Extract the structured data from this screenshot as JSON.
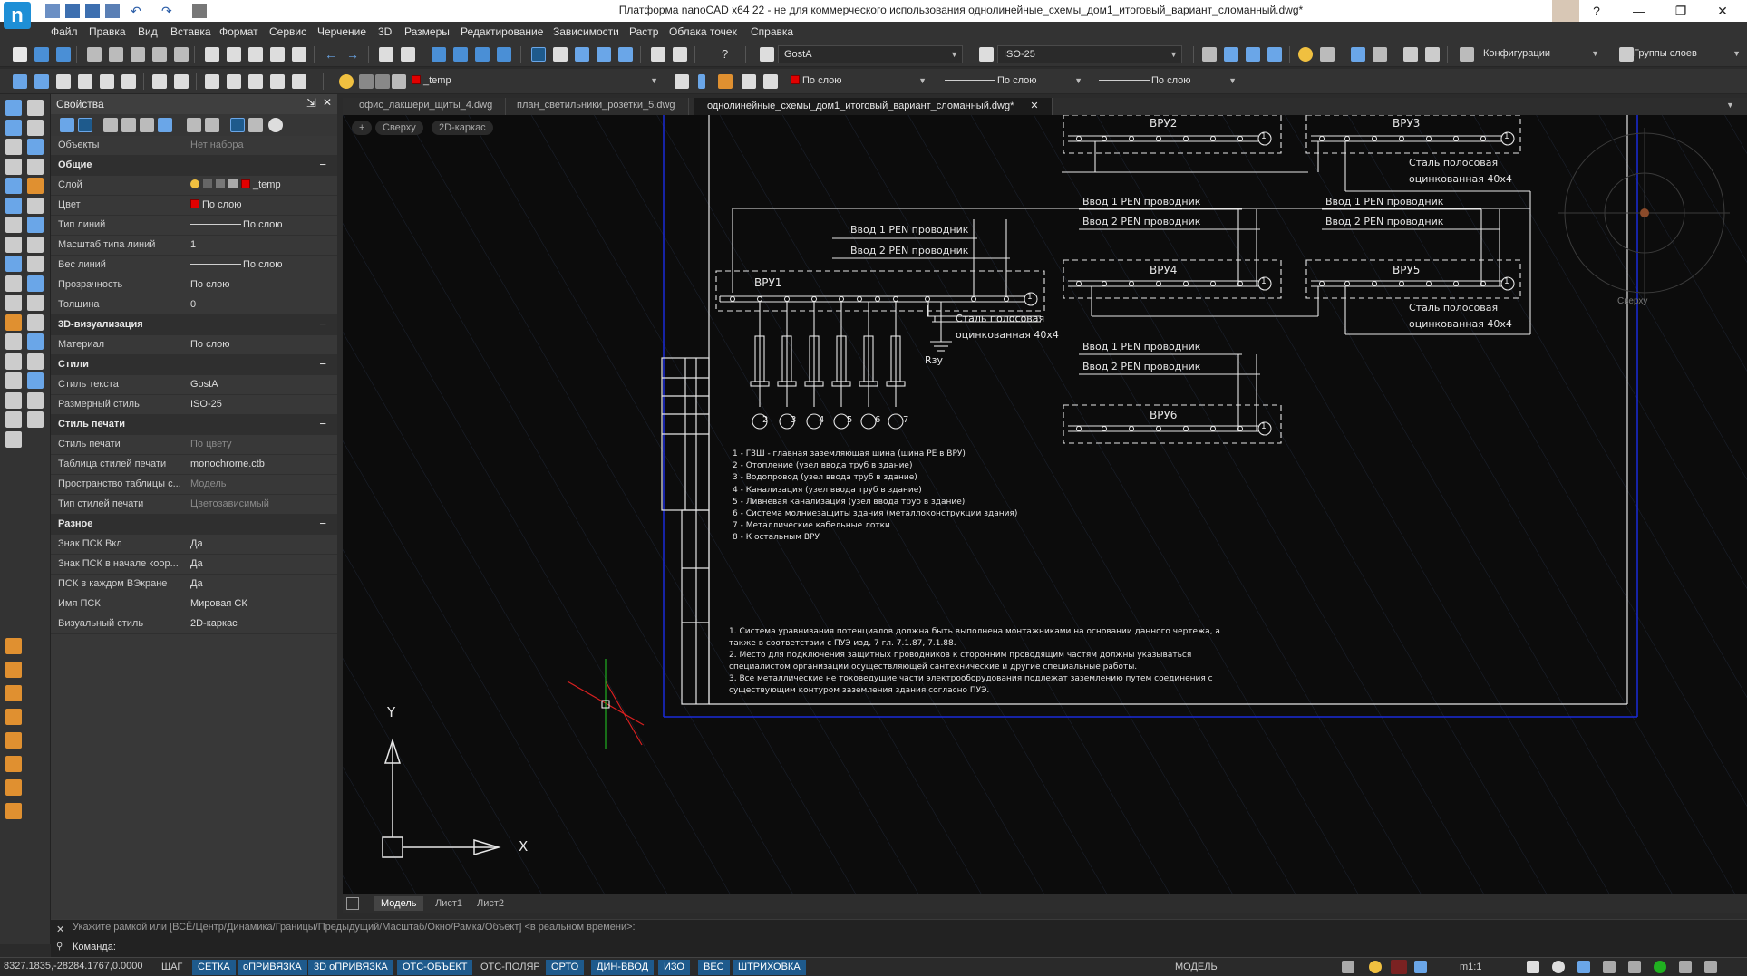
{
  "window": {
    "title": "Платформа nanoCAD x64 22 - не для коммерческого использования однолинейные_схемы_дом1_итоговый_вариант_сломанный.dwg*",
    "logo": "n",
    "minimize": "—",
    "maximize": "❐",
    "close": "✕"
  },
  "menu": [
    "Файл",
    "Правка",
    "Вид",
    "Вставка",
    "Формат",
    "Сервис",
    "Черчение",
    "3D",
    "Размеры",
    "Редактирование",
    "Зависимости",
    "Растр",
    "Облака точек",
    "Справка"
  ],
  "toolbar1": {
    "text_style": "GostA",
    "dim_style": "ISO-25",
    "configurations": "Конфигурации",
    "layer_groups": "Группы слоев"
  },
  "toolbar2": {
    "layer": "_temp",
    "color": "По слою",
    "linetype": "По слою",
    "lineweight": "По слою"
  },
  "properties": {
    "title": "Свойства",
    "objects_label": "Объекты",
    "objects_value": "Нет набора",
    "sections": {
      "general": "Общие",
      "viz3d": "3D-визуализация",
      "styles": "Стили",
      "plot_style": "Стиль печати",
      "misc": "Разное"
    },
    "general_rows": [
      {
        "label": "Слой",
        "value": "_temp"
      },
      {
        "label": "Цвет",
        "value": "По слою"
      },
      {
        "label": "Тип линий",
        "value": "По слою"
      },
      {
        "label": "Масштаб типа линий",
        "value": "1"
      },
      {
        "label": "Вес линий",
        "value": "По слою"
      },
      {
        "label": "Прозрачность",
        "value": "По слою"
      },
      {
        "label": "Толщина",
        "value": "0"
      }
    ],
    "viz_rows": [
      {
        "label": "Материал",
        "value": "По слою"
      }
    ],
    "style_rows": [
      {
        "label": "Стиль текста",
        "value": "GostA"
      },
      {
        "label": "Размерный стиль",
        "value": "ISO-25"
      }
    ],
    "plot_rows": [
      {
        "label": "Стиль печати",
        "value": "По цвету"
      },
      {
        "label": "Таблица стилей печати",
        "value": "monochrome.ctb"
      },
      {
        "label": "Пространство таблицы с...",
        "value": "Модель"
      },
      {
        "label": "Тип стилей печати",
        "value": "Цветозависимый"
      }
    ],
    "misc_rows": [
      {
        "label": "Знак ПСК Вкл",
        "value": "Да"
      },
      {
        "label": "Знак ПСК в начале коор...",
        "value": "Да"
      },
      {
        "label": "ПСК в каждом ВЭкране",
        "value": "Да"
      },
      {
        "label": "Имя ПСК",
        "value": "Мировая СК"
      },
      {
        "label": "Визуальный стиль",
        "value": "2D-каркас"
      }
    ]
  },
  "doc_tabs": [
    {
      "label": "офис_лакшери_щиты_4.dwg"
    },
    {
      "label": "план_светильники_розетки_5.dwg"
    },
    {
      "label": "однолинейные_схемы_дом1_итоговый_вариант_сломанный.dwg*"
    }
  ],
  "viewport": {
    "plus": "+",
    "view": "Сверху",
    "style": "2D-каркас",
    "viewcube_label": "Сверху"
  },
  "drawing": {
    "vru1": "ВРУ1",
    "vru2": "ВРУ2",
    "vru3": "ВРУ3",
    "vru4": "ВРУ4",
    "vru5": "ВРУ5",
    "vru6": "ВРУ6",
    "input1": "Ввод 1 PEN проводник",
    "input2": "Ввод 2 PEN проводник",
    "steel1": "Сталь полосовая",
    "steel2": "оцинкованная 40х4",
    "rzu": "Rзу",
    "circle_one": "1",
    "numbers": [
      "2",
      "3",
      "4",
      "5",
      "6",
      "7"
    ],
    "legend": [
      "1 - ГЗШ - главная заземляющая шина  (шина PE в ВРУ)",
      "2 - Отопление (узел ввода труб в здание)",
      "3 - Водопровод (узел ввода труб в здание)",
      "4 - Канализация (узел ввода труб в здание)",
      "5 - Ливневая канализация (узел ввода труб в здание)",
      "6 - Система молниезащиты здания (металлоконструкции здания)",
      "7 - Металлические кабельные лотки",
      "8 - К остальным ВРУ"
    ],
    "notes": [
      "1. Система уравнивания потенциалов должна быть выполнена монтажниками на основании данного чертежа, а",
      "также в соответствии с ПУЭ изд. 7 гл. 7.1.87, 7.1.88.",
      "2. Место для подключения защитных проводников к сторонним проводящим частям должны указываться",
      "специалистом организации осуществляющей сантехнические и другие специальные работы.",
      "3. Все металлические не токоведущие части электрооборудования подлежат заземлению путем соединения с",
      "существующим контуром заземления здания согласно ПУЭ."
    ],
    "ucs_x": "X",
    "ucs_y": "Y"
  },
  "layout_tabs": [
    "Модель",
    "Лист1",
    "Лист2"
  ],
  "command": {
    "history": "Укажите  рамкой  или  [ВСЁ/Центр/Динамика/Границы/Предыдущий/Масштаб/Окно/Рамка/Объект]  <в  реальном  времени>:",
    "prompt": "Команда:"
  },
  "status": {
    "coords": "8327.1835,-28284.1767,0.0000",
    "buttons": [
      "ШАГ",
      "СЕТКА",
      "оПРИВЯЗКА",
      "3D оПРИВЯЗКА",
      "ОТС-ОБЪЕКТ",
      "ОТС-ПОЛЯР",
      "ОРТО",
      "ДИН-ВВОД",
      "ИЗО",
      "ВЕС",
      "ШТРИХОВКА"
    ],
    "model": "МОДЕЛЬ",
    "scale": "m1:1"
  },
  "colors": {
    "accent": "#1e5a8c",
    "layer_red": "#e10000",
    "frame_blue": "#1a2bd8"
  }
}
